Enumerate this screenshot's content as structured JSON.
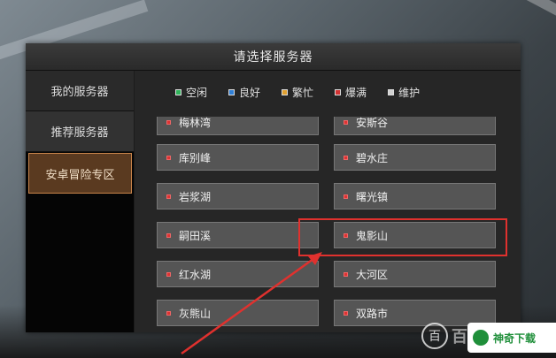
{
  "dialog": {
    "title": "请选择服务器"
  },
  "sidebar": {
    "items": [
      {
        "label": "我的服务器"
      },
      {
        "label": "推荐服务器"
      },
      {
        "label": "安卓冒险专区",
        "active": true
      }
    ]
  },
  "legend": [
    {
      "label": "空闲",
      "color": "#2fb35a"
    },
    {
      "label": "良好",
      "color": "#2f7fd6"
    },
    {
      "label": "繁忙",
      "color": "#e0a030"
    },
    {
      "label": "爆满",
      "color": "#d33333"
    },
    {
      "label": "维护",
      "color": "#d0d0d0"
    }
  ],
  "servers": [
    {
      "left": "梅林湾",
      "right": "安斯谷"
    },
    {
      "left": "库别峰",
      "right": "碧水庄"
    },
    {
      "left": "岩浆湖",
      "right": "曙光镇"
    },
    {
      "left": "嗣田溪",
      "right": "鬼影山"
    },
    {
      "left": "红水湖",
      "right": "大河区"
    },
    {
      "left": "灰熊山",
      "right": "双路市"
    }
  ],
  "watermark": {
    "logo": "百",
    "text": "百度",
    "badge": "神奇下载"
  }
}
